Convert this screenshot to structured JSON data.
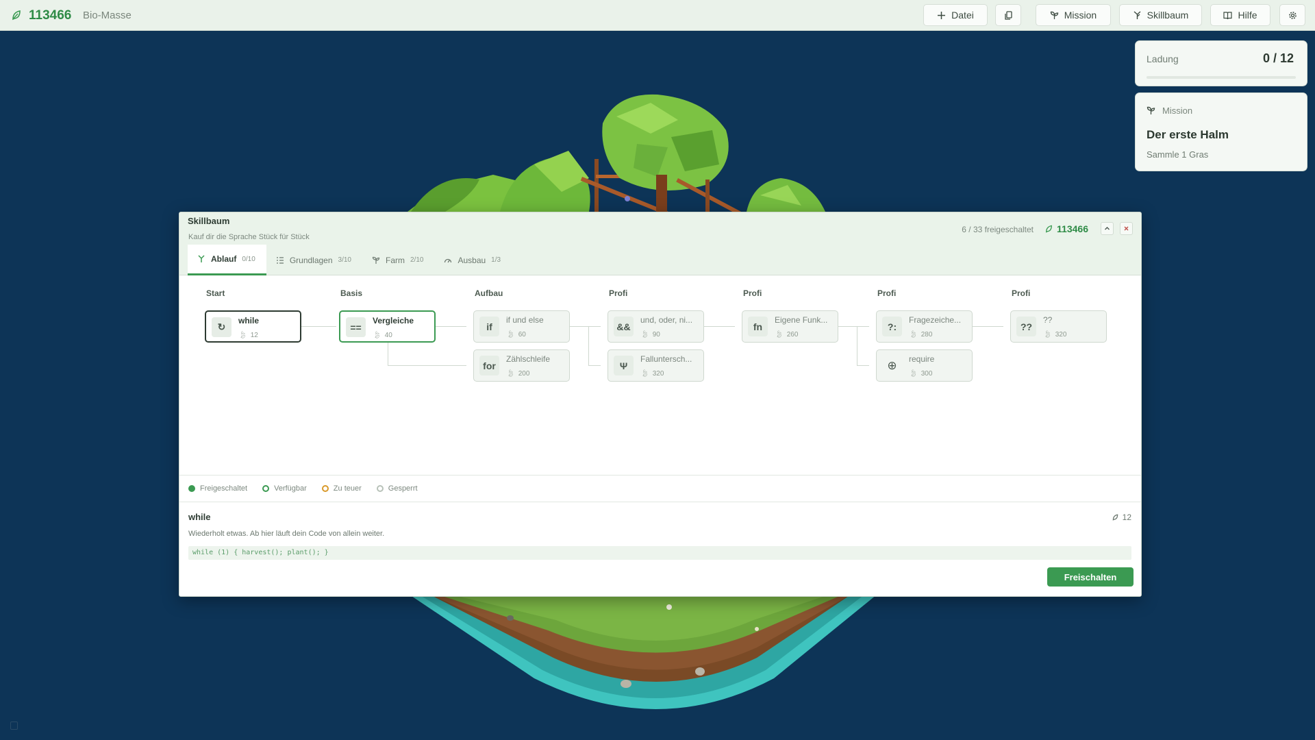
{
  "topbar": {
    "bio_count": "113466",
    "bio_label": "Bio-Masse",
    "btn_datei": "Datei",
    "btn_mission": "Mission",
    "btn_skillbaum": "Skillbaum",
    "btn_hilfe": "Hilfe"
  },
  "ladung": {
    "label": "Ladung",
    "value": "0 / 12",
    "fill_fraction": 0
  },
  "mission": {
    "header": "Mission",
    "title": "Der erste Halm",
    "subtitle": "Sammle 1 Gras"
  },
  "skilltree": {
    "title": "Skillbaum",
    "subtitle": "Kauf dir die Sprache Stück für Stück",
    "status": "6 / 33 freigeschaltet",
    "bio": "113466",
    "tabs": [
      {
        "label": "Ablauf",
        "count": "0/10",
        "icon": "sprout-icon"
      },
      {
        "label": "Grundlagen",
        "count": "3/10",
        "icon": "list-icon"
      },
      {
        "label": "Farm",
        "count": "2/10",
        "icon": "plant-icon"
      },
      {
        "label": "Ausbau",
        "count": "1/3",
        "icon": "gauge-icon"
      }
    ],
    "columns": [
      "Start",
      "Basis",
      "Aufbau",
      "Profi",
      "Profi",
      "Profi",
      "Profi"
    ],
    "nodes": [
      {
        "icon": "↻",
        "name": "while",
        "cost": "12"
      },
      {
        "icon": "==",
        "name": "Vergleiche",
        "cost": "40"
      },
      {
        "icon": "if",
        "name": "if und else",
        "cost": "60"
      },
      {
        "icon": "for",
        "name": "Zählschleife",
        "cost": "200"
      },
      {
        "icon": "&&",
        "name": "und, oder, ni...",
        "cost": "90"
      },
      {
        "icon": "Ψ",
        "name": "Falluntersch...",
        "cost": "320"
      },
      {
        "icon": "fn",
        "name": "Eigene Funk...",
        "cost": "260"
      },
      {
        "icon": "?:",
        "name": "Fragezeiche...",
        "cost": "280"
      },
      {
        "icon": "⊕",
        "name": "require",
        "cost": "300"
      },
      {
        "icon": "??",
        "name": "??",
        "cost": "320"
      }
    ],
    "legend": [
      {
        "label": "Freigeschaltet",
        "color": "#3b9a52"
      },
      {
        "label": "Verfügbar",
        "color": "#3b9a52"
      },
      {
        "label": "Zu teuer",
        "color": "#d99a2b"
      },
      {
        "label": "Gesperrt",
        "color": "#b8c2b9"
      }
    ],
    "detail": {
      "name": "while",
      "cost": "12",
      "description": "Wiederholt etwas. Ab hier läuft dein Code von allein weiter.",
      "code": "while (1) { harvest(); plant(); }",
      "button": "Freischalten"
    }
  },
  "colors": {
    "accent": "#3b9a52",
    "background": "#0d3457",
    "topbar": "#eaf2ea"
  }
}
